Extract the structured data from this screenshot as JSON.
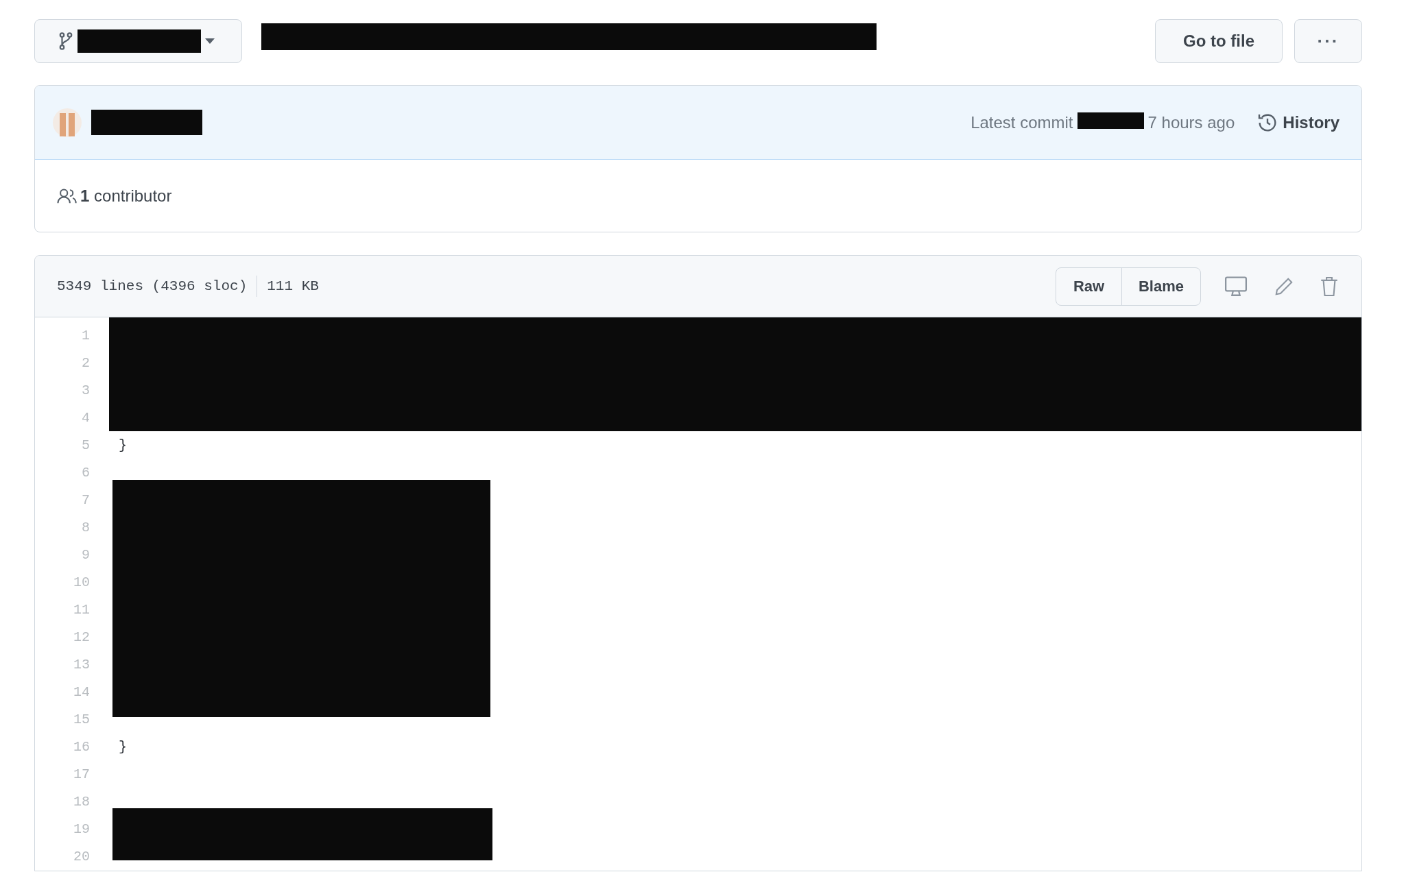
{
  "top_bar": {
    "buttons": [
      {
        "kind": "text",
        "label": "Go to file"
      },
      {
        "kind": "more",
        "label": "···"
      }
    ]
  },
  "commit": {
    "prefix": "Latest commit",
    "time": "7 hours ago",
    "history": "History"
  },
  "contributors": "**1** contributor",
  "file": {
    "lines": "5349 lines (4396 sloc)",
    "size": "111 KB",
    "view_buttons": [
      "Raw",
      "Blame"
    ]
  },
  "code": [
    {
      "number": "1"
    },
    {
      "number": "2"
    },
    {
      "number": "3"
    },
    {
      "number": "4"
    },
    {
      "number": "5",
      "text": "}"
    },
    {
      "number": "6"
    },
    {
      "number": "7"
    },
    {
      "number": "8"
    },
    {
      "number": "9"
    },
    {
      "number": "10"
    },
    {
      "number": "11"
    },
    {
      "number": "12"
    },
    {
      "number": "13"
    },
    {
      "number": "14"
    },
    {
      "number": "15"
    },
    {
      "number": "16",
      "text": "}"
    },
    {
      "number": "17"
    },
    {
      "number": "18"
    },
    {
      "number": "19"
    },
    {
      "number": "20"
    }
  ]
}
